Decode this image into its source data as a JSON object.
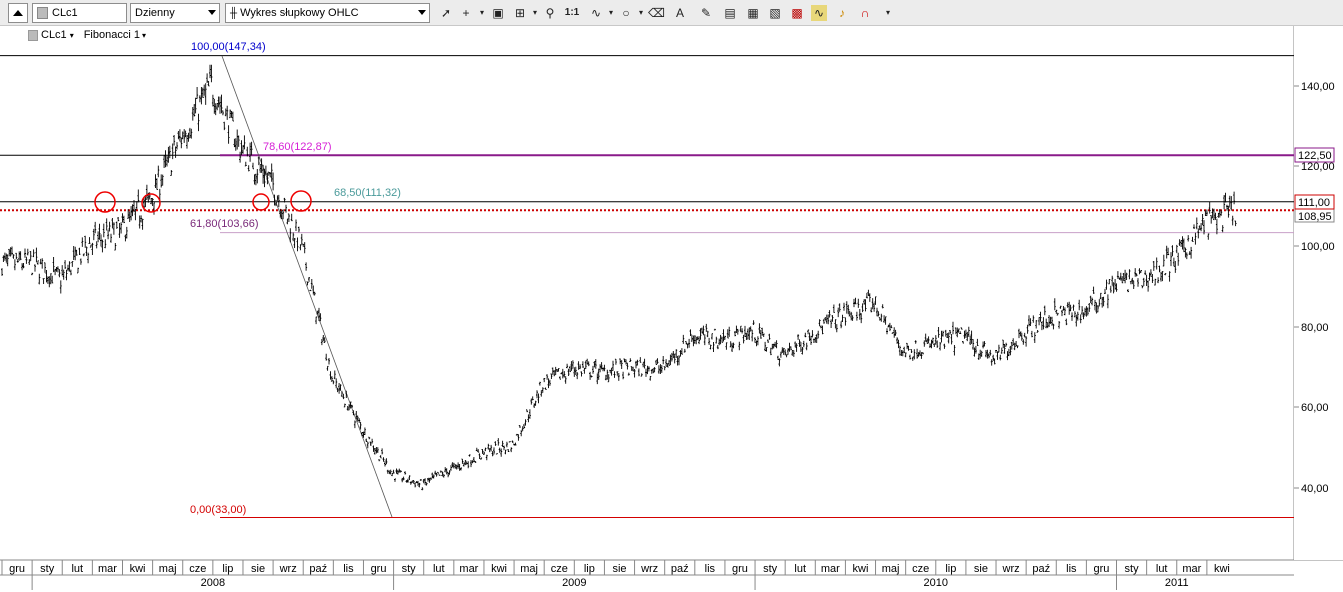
{
  "toolbar": {
    "symbol": "CLc1",
    "interval": "Dzienny",
    "chart_type": "Wykres słupkowy OHLC",
    "zoom_label": "1:1",
    "tools": [
      "cursor-icon",
      "crosshair-icon",
      "info-icon",
      "grid-icon",
      "zoom-icon",
      "zoom-1to1-icon",
      "indicator-icon",
      "ellipse-icon",
      "eraser-icon",
      "text-icon",
      "pencil-icon",
      "template-icon",
      "template-icon",
      "layers-icon",
      "wave-icon",
      "alarm-icon",
      "magnet-icon",
      "more-icon"
    ]
  },
  "legend": {
    "symbol": "CLc1",
    "study": "Fibonacci 1"
  },
  "fib_labels": {
    "l100": "100,00(147,34)",
    "l786": "78,60(122,87)",
    "l685": "68,50(111,32)",
    "l618": "61,80(103,66)",
    "l0": "0,00(33,00)"
  },
  "price_tags": {
    "t1225": "122,50",
    "t111": "111,00",
    "t1089": "108,95"
  },
  "y_axis": {
    "ticks": [
      "140,00",
      "120,00",
      "100,00",
      "80,00",
      "60,00",
      "40,00"
    ]
  },
  "x_axis": {
    "months": [
      "gru",
      "sty",
      "lut",
      "mar",
      "kwi",
      "maj",
      "cze",
      "lip",
      "sie",
      "wrz",
      "paź",
      "lis",
      "gru",
      "sty",
      "lut",
      "mar",
      "kwi",
      "maj",
      "cze",
      "lip",
      "sie",
      "wrz",
      "paź",
      "lis",
      "gru",
      "sty",
      "lut",
      "mar",
      "kwi",
      "maj",
      "cze",
      "lip",
      "sie",
      "wrz",
      "paź",
      "lis",
      "gru",
      "sty",
      "lut",
      "mar",
      "kwi"
    ],
    "years": [
      "2008",
      "2009",
      "2010",
      "2011"
    ]
  },
  "colors": {
    "fib100": "#0000cc",
    "fib786": "#d61fd6",
    "fib685": "#4a9a9a",
    "fib618": "#7a2a7a",
    "fib0": "#d40000",
    "resistance_purple": "#8a1a8a",
    "support_red": "#cc0000"
  },
  "chart_data": {
    "type": "ohlc",
    "series": [
      {
        "name": "CLc1",
        "monthly_close": [
          {
            "x": "2007-12",
            "y": 96
          },
          {
            "x": "2008-01",
            "y": 92
          },
          {
            "x": "2008-02",
            "y": 101
          },
          {
            "x": "2008-03",
            "y": 104
          },
          {
            "x": "2008-04",
            "y": 112
          },
          {
            "x": "2008-05",
            "y": 127
          },
          {
            "x": "2008-06",
            "y": 140
          },
          {
            "x": "2008-07",
            "y": 124
          },
          {
            "x": "2008-08",
            "y": 116
          },
          {
            "x": "2008-09",
            "y": 100
          },
          {
            "x": "2008-10",
            "y": 68
          },
          {
            "x": "2008-11",
            "y": 55
          },
          {
            "x": "2008-12",
            "y": 44
          },
          {
            "x": "2009-01",
            "y": 41
          },
          {
            "x": "2009-02",
            "y": 45
          },
          {
            "x": "2009-03",
            "y": 49
          },
          {
            "x": "2009-04",
            "y": 51
          },
          {
            "x": "2009-05",
            "y": 66
          },
          {
            "x": "2009-06",
            "y": 70
          },
          {
            "x": "2009-07",
            "y": 69
          },
          {
            "x": "2009-08",
            "y": 70
          },
          {
            "x": "2009-09",
            "y": 70
          },
          {
            "x": "2009-10",
            "y": 78
          },
          {
            "x": "2009-11",
            "y": 77
          },
          {
            "x": "2009-12",
            "y": 79
          },
          {
            "x": "2010-01",
            "y": 73
          },
          {
            "x": "2010-02",
            "y": 79
          },
          {
            "x": "2010-03",
            "y": 83
          },
          {
            "x": "2010-04",
            "y": 86
          },
          {
            "x": "2010-05",
            "y": 74
          },
          {
            "x": "2010-06",
            "y": 76
          },
          {
            "x": "2010-07",
            "y": 78
          },
          {
            "x": "2010-08",
            "y": 72
          },
          {
            "x": "2010-09",
            "y": 79
          },
          {
            "x": "2010-10",
            "y": 83
          },
          {
            "x": "2010-11",
            "y": 84
          },
          {
            "x": "2010-12",
            "y": 91
          },
          {
            "x": "2011-01",
            "y": 92
          },
          {
            "x": "2011-02",
            "y": 97
          },
          {
            "x": "2011-03",
            "y": 106
          },
          {
            "x": "2011-04",
            "y": 109
          }
        ]
      }
    ],
    "fibonacci": [
      {
        "level": "100,00",
        "price": 147.34
      },
      {
        "level": "78,60",
        "price": 122.87
      },
      {
        "level": "68,50",
        "price": 111.32
      },
      {
        "level": "61,80",
        "price": 103.66
      },
      {
        "level": "0,00",
        "price": 33.0
      }
    ],
    "horizontal_lines": [
      147.34,
      122.5,
      111.0,
      108.95,
      33.0
    ],
    "ylim": [
      28,
      152
    ],
    "y_ticks": [
      40,
      60,
      80,
      100,
      120,
      140
    ]
  }
}
